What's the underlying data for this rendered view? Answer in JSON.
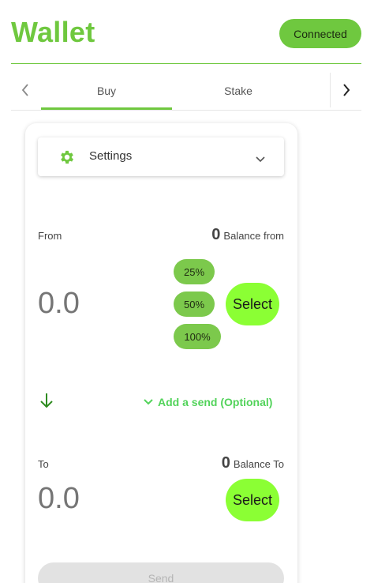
{
  "header": {
    "title": "Wallet",
    "status_label": "Connected"
  },
  "tabs": {
    "items": [
      {
        "label": "Buy",
        "active": true
      },
      {
        "label": "Stake",
        "active": false
      }
    ]
  },
  "settings": {
    "label": "Settings",
    "icon": "gear-icon"
  },
  "from": {
    "label": "From",
    "balance_value": "0",
    "balance_label": "Balance from",
    "amount_placeholder": "0.0",
    "percent_buttons": [
      "25%",
      "50%",
      "100%"
    ],
    "select_label": "Select"
  },
  "add_send": {
    "label": "Add a send (Optional)"
  },
  "to": {
    "label": "To",
    "balance_value": "0",
    "balance_label": "Balance To",
    "amount_placeholder": "0.0",
    "select_label": "Select"
  },
  "send": {
    "label": "Send"
  },
  "colors": {
    "accent": "#6fc83f",
    "select_button": "#8bff34",
    "percent_button": "#7cc94c",
    "link": "#52d35a"
  }
}
